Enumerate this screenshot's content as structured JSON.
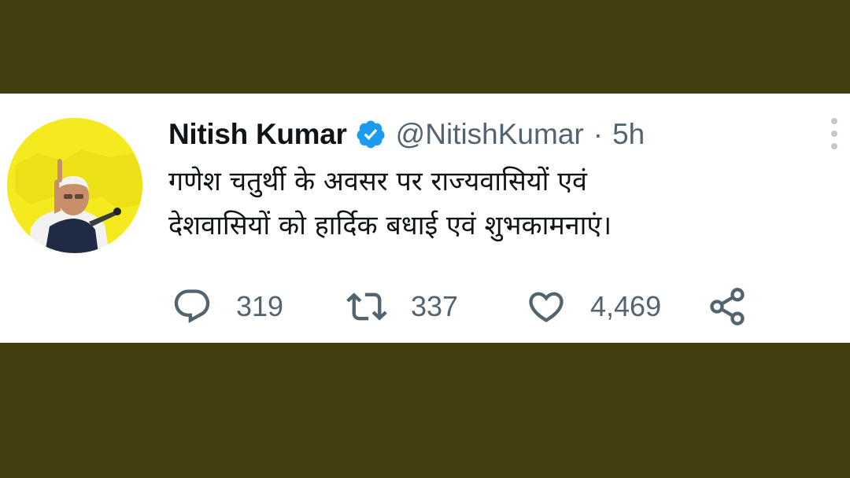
{
  "tweet": {
    "display_name": "Nitish Kumar",
    "handle": "@NitishKumar",
    "separator": "·",
    "time": "5h",
    "text_lines": [
      "गणेश चतुर्थी के अवसर पर राज्यवासियों एवं",
      "देशवासियों को हार्दिक बधाई एवं शुभकामनाएं।"
    ],
    "verified": true
  },
  "actions": {
    "reply_count": "319",
    "retweet_count": "337",
    "like_count": "4,469"
  },
  "icons": {
    "verified": "verified-badge-icon",
    "more": "more-options-icon",
    "reply": "reply-icon",
    "retweet": "retweet-icon",
    "like": "heart-icon",
    "share": "share-icon"
  },
  "colors": {
    "background": "#433f10",
    "card": "#ffffff",
    "name": "#0f1419",
    "secondary": "#536471",
    "verified": "#1d9bf0",
    "avatar_bg": "#f4ea1e"
  }
}
